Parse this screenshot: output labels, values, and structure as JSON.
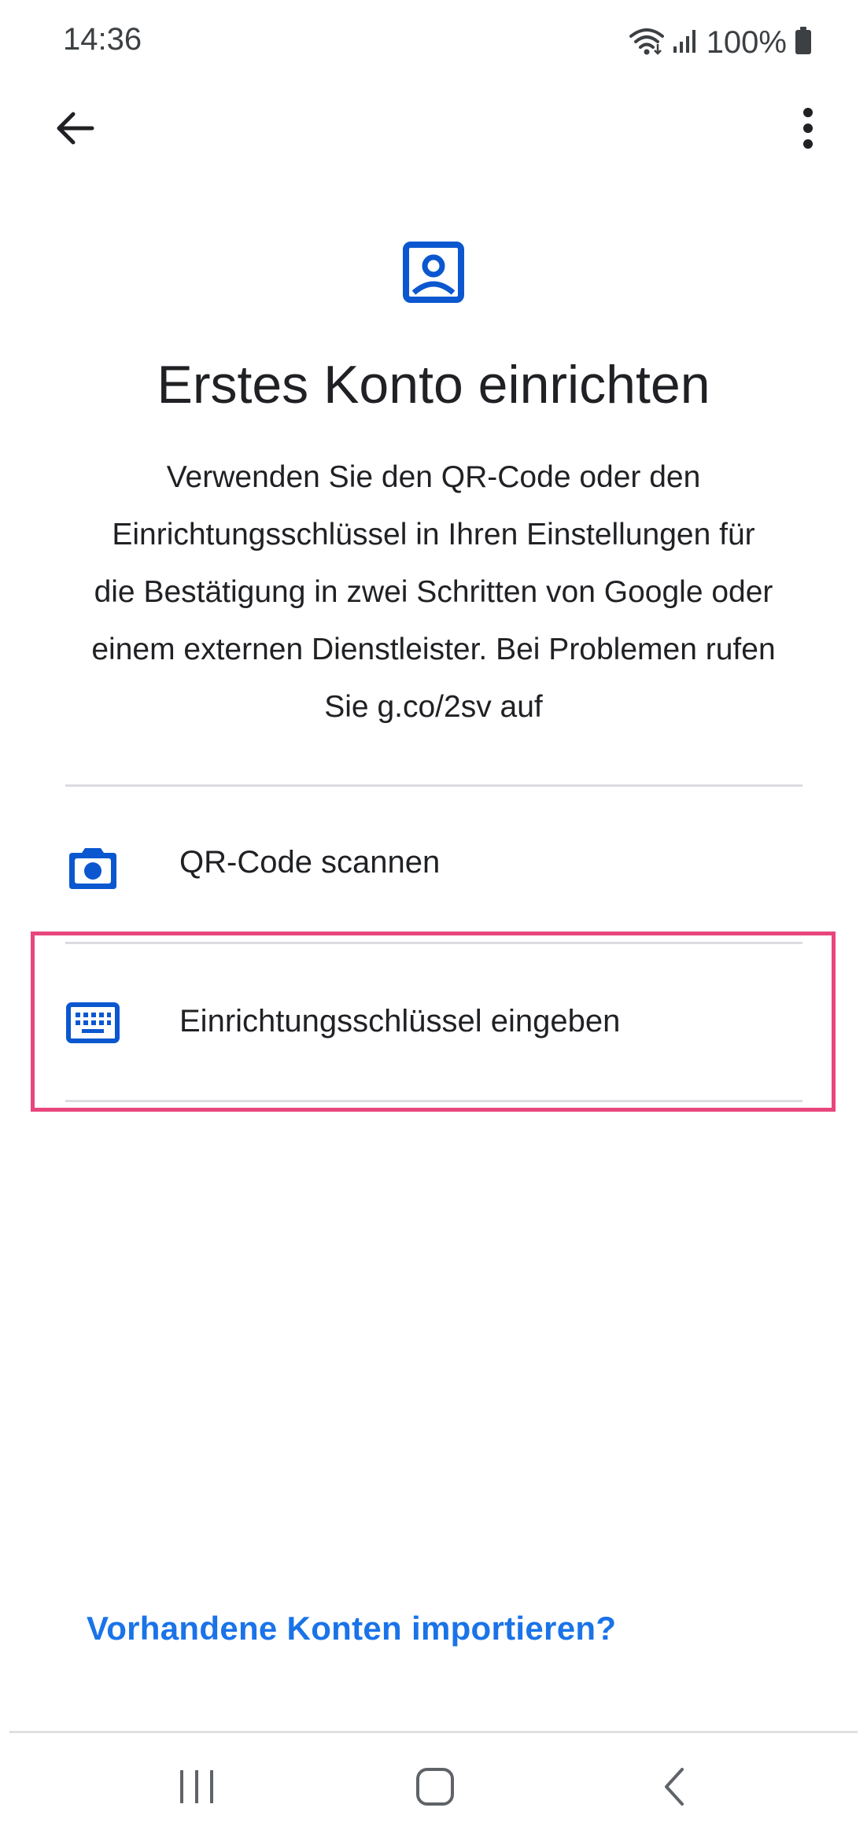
{
  "status_bar": {
    "time": "14:36",
    "battery": "100%",
    "icons": [
      "wifi-icon",
      "signal-icon",
      "battery-icon"
    ]
  },
  "app_bar": {
    "back_icon": "arrow-back-icon",
    "menu_icon": "more-vert-icon"
  },
  "main": {
    "hero_icon": "account-box-icon",
    "title": "Erstes Konto einrichten",
    "description_lines": [
      "Verwenden Sie den QR-Code oder den",
      "Einrichtungsschlüssel in Ihren Einstellungen für",
      "die Bestätigung in zwei Schritten von Google oder",
      "einem externen Dienstleister. Bei Problemen rufen",
      "Sie g.co/2sv auf"
    ],
    "options": [
      {
        "label": "QR-Code scannen",
        "icon": "camera-icon"
      },
      {
        "label": "Einrichtungsschlüssel eingeben",
        "icon": "keyboard-icon"
      }
    ],
    "import_link": "Vorhandene Konten importieren?"
  },
  "nav_bar": {
    "icons": [
      "recent-apps-icon",
      "home-icon",
      "back-icon"
    ]
  },
  "colors": {
    "accent": "#1a73e8",
    "icon_blue": "#0b57d0",
    "highlight": "#e8467c",
    "divider": "#dadce0"
  }
}
